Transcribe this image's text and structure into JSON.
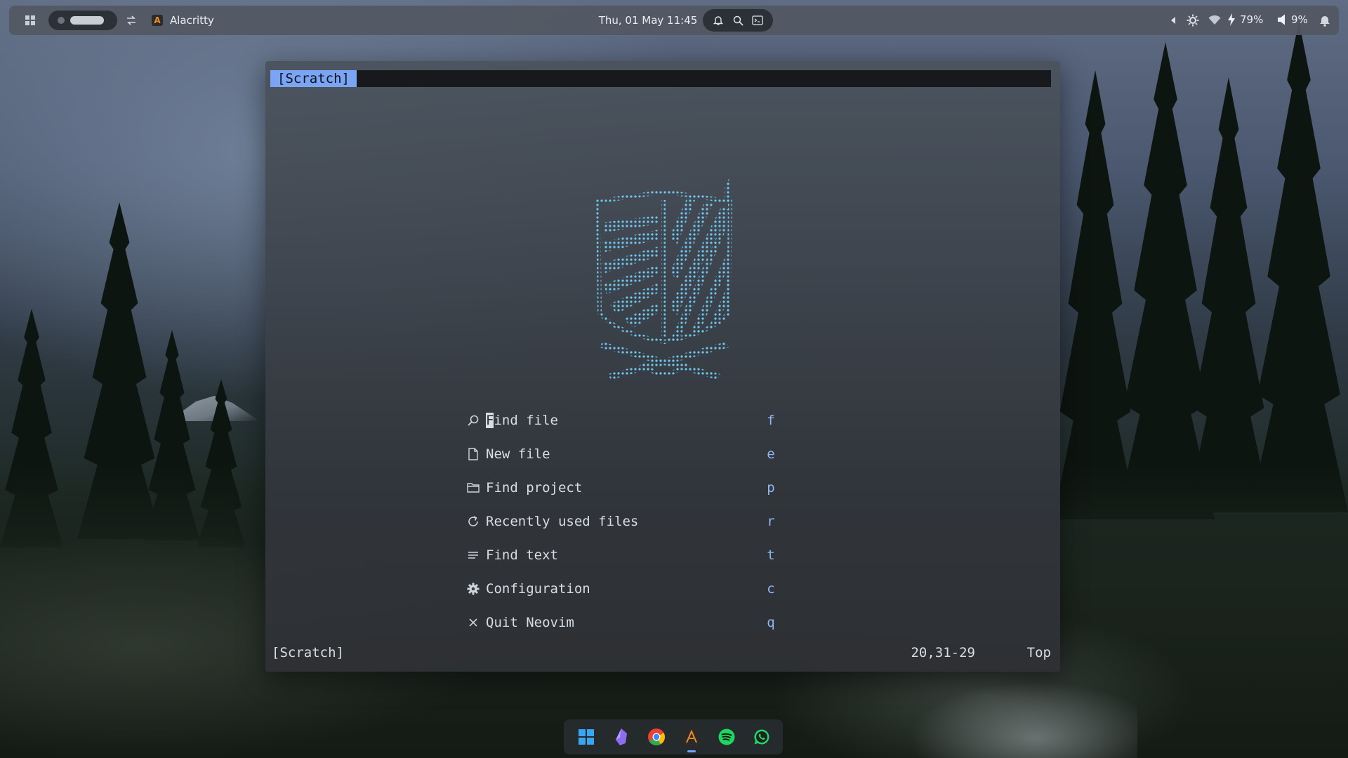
{
  "topbar": {
    "app_name": "Alacritty",
    "datetime": "Thu, 01 May 11:45",
    "battery": "79%",
    "volume": "9%"
  },
  "terminal": {
    "tab_label": "[Scratch]",
    "menu": [
      {
        "icon": "search-icon",
        "label": "Find file",
        "key": "f"
      },
      {
        "icon": "file-icon",
        "label": "New file",
        "key": "e"
      },
      {
        "icon": "folder-icon",
        "label": "Find project",
        "key": "p"
      },
      {
        "icon": "refresh-icon",
        "label": "Recently used files",
        "key": "r"
      },
      {
        "icon": "lines-icon",
        "label": "Find text",
        "key": "t"
      },
      {
        "icon": "gear-icon",
        "label": "Configuration",
        "key": "c"
      },
      {
        "icon": "close-icon",
        "label": "Quit Neovim",
        "key": "q"
      }
    ],
    "cursor_char": "F",
    "first_label_rest": "ind file",
    "statusline": {
      "buffer": "[Scratch]",
      "position": "20,31-29",
      "scroll": "Top"
    }
  },
  "dock": {
    "apps": [
      "windows-start-icon",
      "obsidian-icon",
      "chrome-icon",
      "alacritty-icon",
      "spotify-icon",
      "whatsapp-icon"
    ]
  },
  "colors": {
    "accent": "#7aa5f5",
    "key_color": "#8fb7ef",
    "logo_color": "#6fc7ef"
  }
}
